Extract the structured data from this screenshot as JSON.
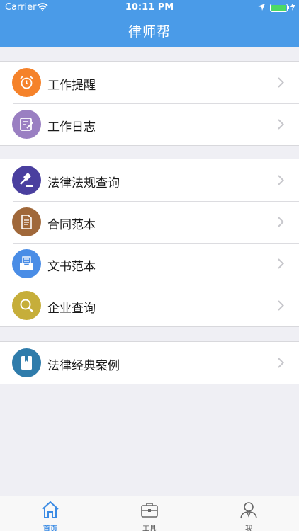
{
  "status_bar": {
    "carrier": "Carrier",
    "time": "10:11 PM"
  },
  "header": {
    "title": "律师帮"
  },
  "groups": [
    [
      {
        "label": "工作提醒",
        "icon": "alarm-clock-icon",
        "color": "#f5822a"
      },
      {
        "label": "工作日志",
        "icon": "notebook-pencil-icon",
        "color": "#9a7fc2"
      }
    ],
    [
      {
        "label": "法律法规查询",
        "icon": "gavel-icon",
        "color": "#4a3f9f"
      },
      {
        "label": "合同范本",
        "icon": "document-icon",
        "color": "#a0683a"
      },
      {
        "label": "文书范本",
        "icon": "inbox-tray-icon",
        "color": "#4a8de6"
      },
      {
        "label": "企业查询",
        "icon": "magnifier-icon",
        "color": "#c6ae3a"
      }
    ],
    [
      {
        "label": "法律经典案例",
        "icon": "book-icon",
        "color": "#2f7cab"
      }
    ]
  ],
  "tabbar": {
    "tabs": [
      {
        "label": "首页",
        "icon": "home-icon",
        "active": true
      },
      {
        "label": "工具",
        "icon": "toolbox-icon",
        "active": false
      },
      {
        "label": "我",
        "icon": "profile-icon",
        "active": false
      }
    ]
  },
  "colors": {
    "accent": "#4a9be8",
    "tab_active": "#3b8be4",
    "background": "#efeff4"
  }
}
